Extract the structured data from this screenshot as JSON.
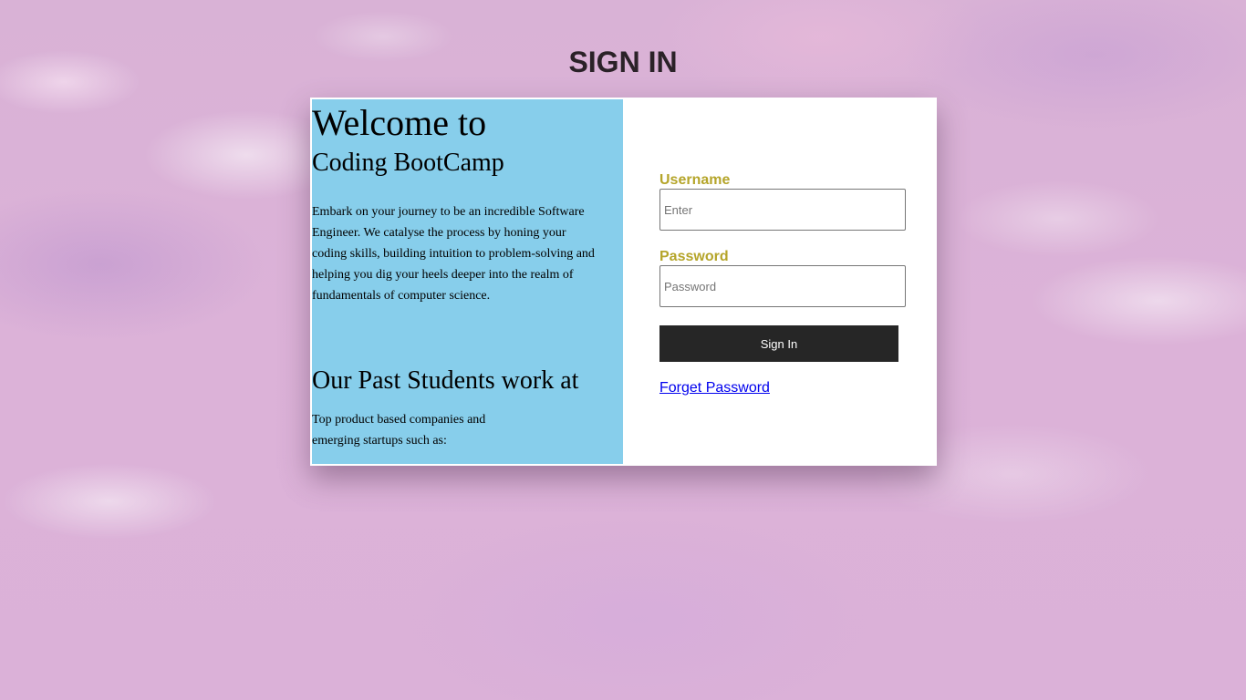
{
  "page": {
    "title": "SIGN IN"
  },
  "left_panel": {
    "welcome_heading": "Welcome to",
    "brand_heading": "Coding BootCamp",
    "intro_text": "Embark on your journey to be an incredible Software Engineer. We catalyse the process by honing your coding skills, building intuition to problem-solving and helping you dig your heels deeper into the realm of fundamentals of computer science.",
    "students_heading": "Our Past Students work at",
    "students_text": "Top product based companies and emerging startups such as:"
  },
  "login_form": {
    "username_label": "Username",
    "username_value": "",
    "username_placeholder": "Enter",
    "password_label": "Password",
    "password_value": "",
    "password_placeholder": "Password",
    "sign_in_button": "Sign In",
    "forget_password_link": "Forget Password"
  },
  "colors": {
    "left_panel_background": "#87ceeb",
    "label_color": "#b5a52a",
    "button_background": "#262626",
    "link_color": "#0000ee"
  }
}
